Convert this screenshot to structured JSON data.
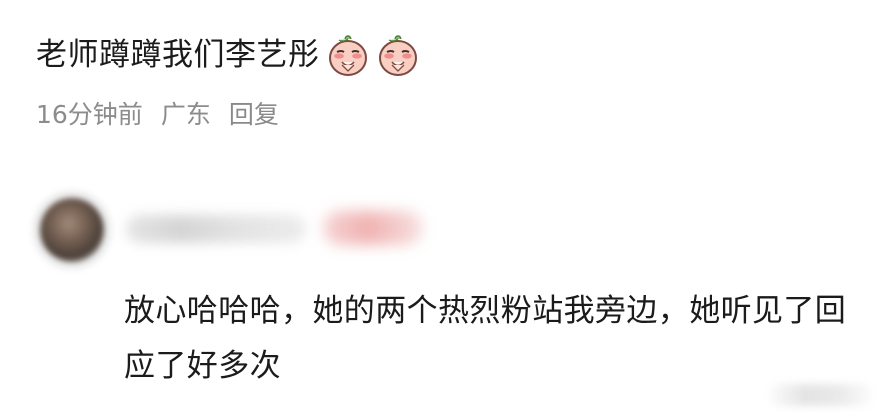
{
  "comment": {
    "text": "老师蹲蹲我们李艺彤",
    "emoji_icon": "blush-peach-praying-emoji",
    "emoji_count": 2,
    "meta": {
      "time": "16分钟前",
      "location": "广东",
      "reply": "回复"
    }
  },
  "reply": {
    "text": "放心哈哈哈，她的两个热烈粉站我旁边，她听见了回应了好多次"
  },
  "colors": {
    "text": "#1b1b1b",
    "meta": "#8c8c8c",
    "badge": "#f0b2b2"
  }
}
